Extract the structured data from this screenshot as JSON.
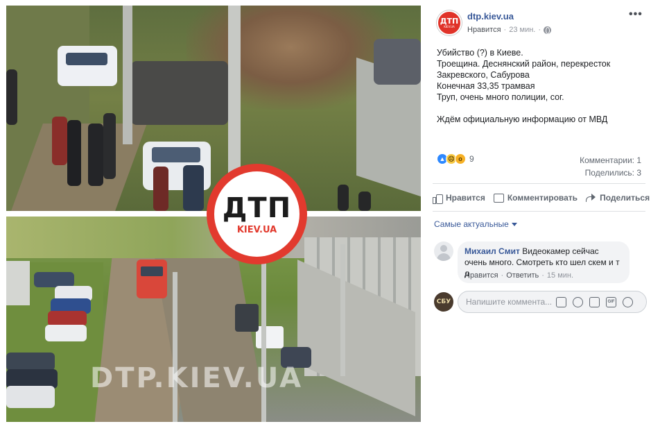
{
  "post": {
    "page_name": "dtp.kiev.ua",
    "avatar_text": "ДТП",
    "avatar_sub": "KIEV.UA",
    "like_link": "Нравится",
    "separator": "·",
    "time": "23 мин.",
    "more_menu": "•••",
    "text_lines": [
      "Убийство (?) в Киеве.",
      "Троещина. Деснянский район, перекресток",
      "Закревского, Сабурова",
      "Конечная 33,35 трамвая",
      "Труп, очень много полиции, сог."
    ],
    "text_last": "Ждём официальную информацию от МВД"
  },
  "photo": {
    "logo_main": "ДТП",
    "logo_sub": "KIEV.UA",
    "watermark": "DTP.KIEV.UA"
  },
  "stats": {
    "reaction_count": "9",
    "comments": "Комментарии: 1",
    "shares": "Поделились: 3"
  },
  "actions": {
    "like": "Нравится",
    "comment": "Комментировать",
    "share": "Поделиться"
  },
  "comments": {
    "sort_label": "Самые актуальные",
    "items": [
      {
        "author": "Михаил Смит",
        "text": "Видеокамер сейчас очень много. Смотреть кто шел скем и т д",
        "like": "Нравится",
        "reply": "Ответить",
        "sep": "·",
        "time": "15 мин."
      }
    ],
    "input_placeholder": "Напишите коммента...",
    "user_avatar_text": "СБУ"
  },
  "colors": {
    "link": "#385898",
    "brand_red": "#e23a2e",
    "muted": "#90949c"
  }
}
